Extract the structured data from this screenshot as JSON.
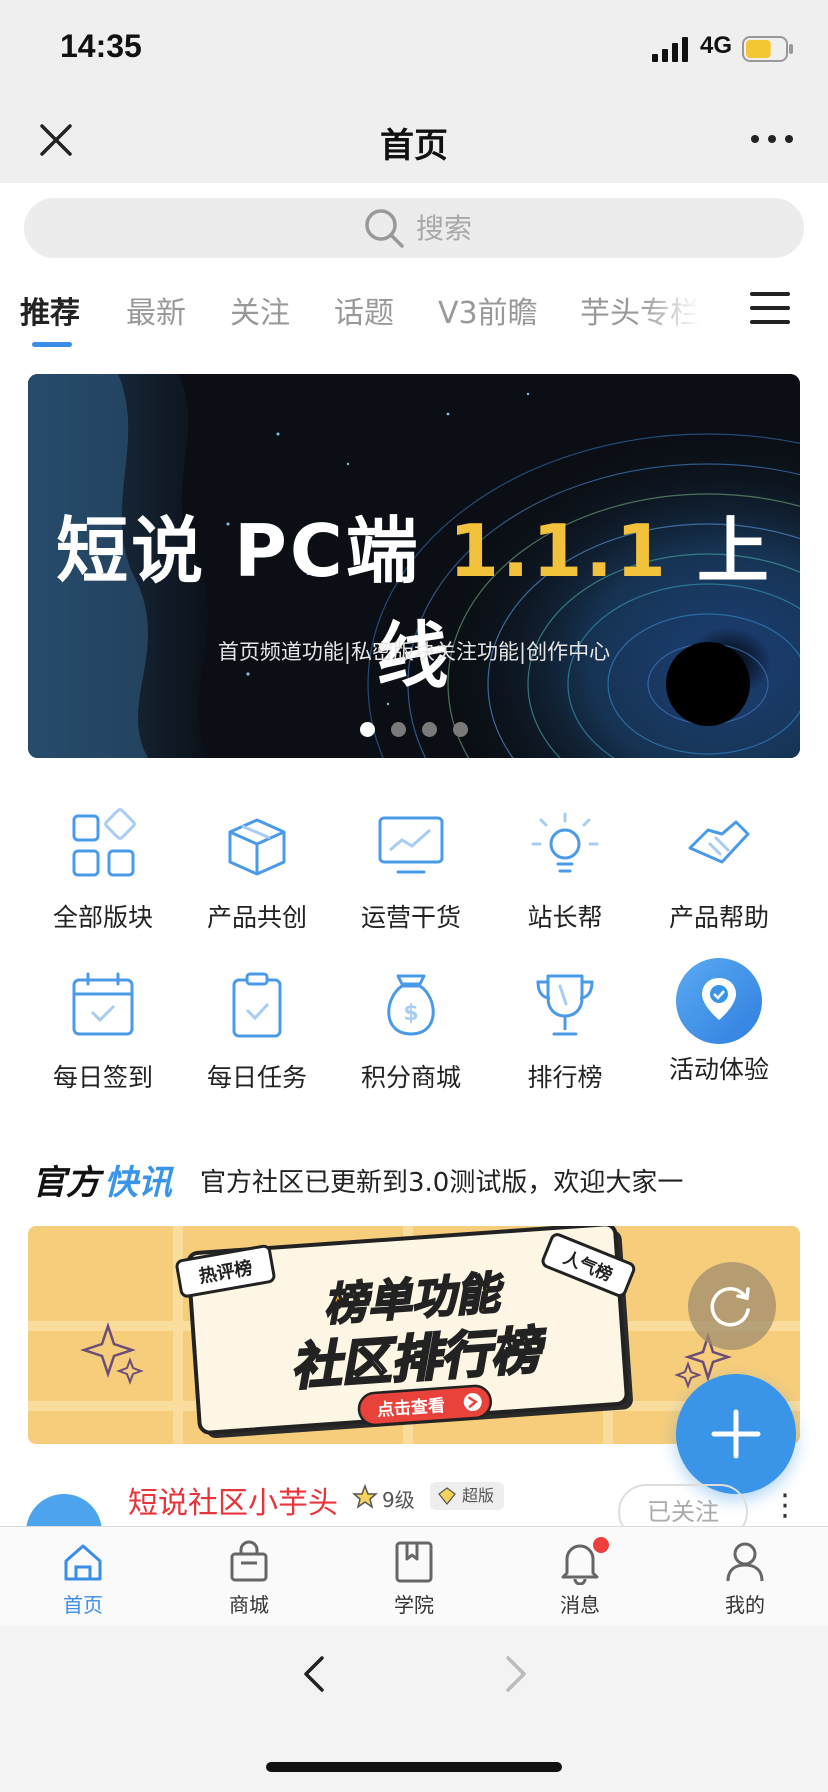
{
  "status_bar": {
    "time": "14:35",
    "network": "4G",
    "battery_level": 0.65
  },
  "nav": {
    "title": "首页",
    "close_icon": "close-icon",
    "more_icon": "more-horizontal-icon"
  },
  "search": {
    "placeholder": "搜索",
    "icon": "search-icon"
  },
  "tabs": [
    {
      "label": "推荐",
      "active": true
    },
    {
      "label": "最新"
    },
    {
      "label": "关注"
    },
    {
      "label": "话题"
    },
    {
      "label": "V3前瞻"
    },
    {
      "label": "芋头专栏"
    }
  ],
  "banner": {
    "title_prefix": "短说 PC端 ",
    "title_version": "1.1.1",
    "title_suffix": " 上线",
    "subtitle": "首页频道功能|私密版块关注功能|创作中心",
    "slide_count": 4,
    "active_slide": 1
  },
  "grid": [
    {
      "label": "全部版块",
      "icon": "grid-icon"
    },
    {
      "label": "产品共创",
      "icon": "box-icon"
    },
    {
      "label": "运营干货",
      "icon": "chart-monitor-icon"
    },
    {
      "label": "站长帮",
      "icon": "lightbulb-icon"
    },
    {
      "label": "产品帮助",
      "icon": "handshake-icon"
    },
    {
      "label": "每日签到",
      "icon": "calendar-check-icon"
    },
    {
      "label": "每日任务",
      "icon": "clipboard-check-icon"
    },
    {
      "label": "积分商城",
      "icon": "money-bag-icon"
    },
    {
      "label": "排行榜",
      "icon": "trophy-icon"
    },
    {
      "label": "活动体验",
      "icon": "location-pin-icon"
    }
  ],
  "news": {
    "logo_left": "官方",
    "logo_right": "快讯",
    "text": "官方社区已更新到3.0测试版，欢迎大家一"
  },
  "promo": {
    "tag_left": "热评榜",
    "tag_right": "人气榜",
    "title_line1": "榜单功能",
    "title_line2": "社区排行榜",
    "cta": "点击查看"
  },
  "post": {
    "author": "短说社区小芋头",
    "level": "9级",
    "badge": "超版",
    "follow_label": "已关注",
    "more": "⋮"
  },
  "tabbar": [
    {
      "label": "首页",
      "icon": "home-icon",
      "active": true
    },
    {
      "label": "商城",
      "icon": "shopping-bag-icon"
    },
    {
      "label": "学院",
      "icon": "book-icon"
    },
    {
      "label": "消息",
      "icon": "bell-icon",
      "badge": true
    },
    {
      "label": "我的",
      "icon": "user-icon"
    }
  ],
  "colors": {
    "accent": "#3a8ee6",
    "author": "#e8343a",
    "banner_version": "#f2c23c",
    "promo_bg": "#f6cd7b"
  }
}
